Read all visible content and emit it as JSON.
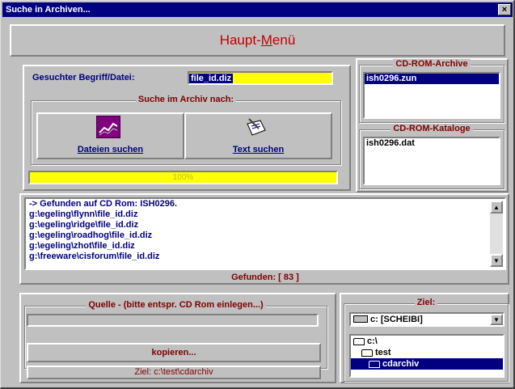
{
  "window": {
    "title": "Suche in Archiven...",
    "close_glyph": "×"
  },
  "main_menu": {
    "label_prefix": "Haupt-",
    "label_accel": "M",
    "label_suffix": "enü"
  },
  "search": {
    "term_label": "Gesuchter Begriff/Datei:",
    "term_value": "file_id.diz",
    "group_title": "Suche im Archiv nach:",
    "btn_files": "Dateien suchen",
    "btn_text": "Text suchen",
    "progress_text": "100%",
    "progress_percent": 100
  },
  "cdrom_archives": {
    "title": "CD-ROM-Archive",
    "items": [
      "ish0296.zun"
    ]
  },
  "cdrom_catalogs": {
    "title": "CD-ROM-Kataloge",
    "items": [
      "ish0296.dat"
    ]
  },
  "results": {
    "lines": [
      "-> Gefunden auf CD Rom: ISH0296.",
      "g:\\egeling\\flynn\\file_id.diz",
      "g:\\egeling\\ridge\\file_id.diz",
      "g:\\egeling\\roadhog\\file_id.diz",
      "g:\\egeling\\zhot\\file_id.diz",
      "g:\\freeware\\cisforum\\file_id.diz"
    ],
    "found_label": "Gefunden: [ 83 ]"
  },
  "source": {
    "group_title": "Quelle - (bitte entspr. CD Rom einlegen...)",
    "copy_button": "kopieren...",
    "target_button": "Ziel: c:\\test\\cdarchiv"
  },
  "target": {
    "group_title": "Ziel:",
    "drive": "c: [SCHEIBI]",
    "dirs": [
      "c:\\",
      "test",
      "cdarchiv"
    ]
  }
}
